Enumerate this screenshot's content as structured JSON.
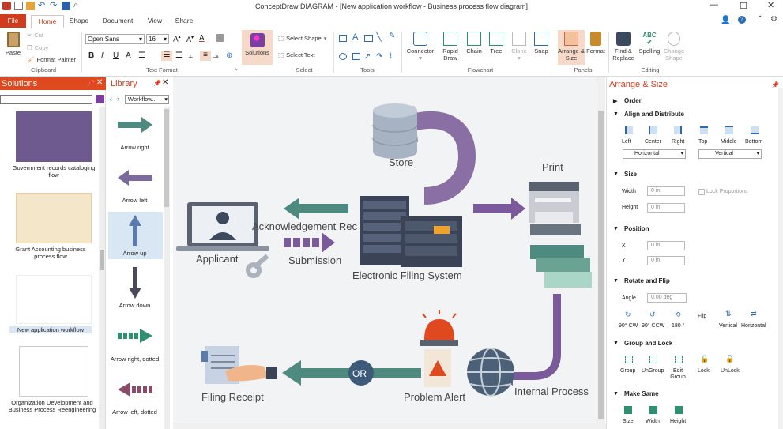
{
  "app": {
    "title": "ConceptDraw DIAGRAM - [New application workflow - Business process flow diagram]"
  },
  "ribbon_tabs": [
    "File",
    "Home",
    "Shape",
    "Document",
    "View",
    "Share"
  ],
  "ribbon": {
    "clipboard": {
      "paste": "Paste",
      "cut": "Cut",
      "copy": "Copy",
      "format_painter": "Format Painter",
      "label": "Clipboard"
    },
    "text_format": {
      "font": "Open Sans",
      "size": "16",
      "label": "Text Format"
    },
    "select": {
      "solutions": "Solutions",
      "select_shape": "Select Shape",
      "select_text": "Select Text",
      "label": "Select"
    },
    "tools": {
      "label": "Tools"
    },
    "flowchart": {
      "connector": "Connector",
      "rapid_draw": "Rapid Draw",
      "chain": "Chain",
      "tree": "Tree",
      "clone": "Clone",
      "snap": "Snap",
      "label": "Flowchart"
    },
    "panels": {
      "arrange_size": "Arrange & Size",
      "format": "Format",
      "label": "Panels"
    },
    "editing": {
      "find_replace": "Find & Replace",
      "spelling": "Spelling",
      "change_shape": "Change Shape",
      "label": "Editing"
    }
  },
  "solutions_panel": {
    "title": "Solutions",
    "items": [
      {
        "caption": "Government records cataloging flow"
      },
      {
        "caption": "Grant Accounting business process flow"
      },
      {
        "caption": "New application workflow"
      },
      {
        "caption": "Organization Development and Business Process Reengineering"
      }
    ]
  },
  "library_panel": {
    "title": "Library",
    "dropdown": "Workflow...",
    "items": [
      {
        "caption": "Arrow right"
      },
      {
        "caption": "Arrow left"
      },
      {
        "caption": "Arrow up"
      },
      {
        "caption": "Arrow down"
      },
      {
        "caption": "Arrow right, dotted"
      },
      {
        "caption": "Arrow left, dotted"
      }
    ]
  },
  "canvas": {
    "labels": {
      "store": "Store",
      "print": "Print",
      "applicant": "Applicant",
      "acknowledgement": "Acknowledgement Rec",
      "submission": "Submission",
      "efs": "Electronic Filing System",
      "filing_receipt": "Filing Receipt",
      "or": "OR",
      "problem_alert": "Problem Alert",
      "internal_process": "Internal Process"
    }
  },
  "arrange_panel": {
    "title": "Arrange & Size",
    "order": "Order",
    "align": {
      "title": "Align and Distribute",
      "buttons": [
        "Left",
        "Center",
        "Right",
        "Top",
        "Middle",
        "Bottom"
      ],
      "horizontal": "Horizontal",
      "vertical": "Vertical"
    },
    "size": {
      "title": "Size",
      "width_label": "Width",
      "width": "0 in",
      "height_label": "Height",
      "height": "0 in",
      "lock": "Lock Proportions"
    },
    "position": {
      "title": "Position",
      "x_label": "X",
      "x": "0 in",
      "y_label": "Y",
      "y": "0 in"
    },
    "rotate": {
      "title": "Rotate and Flip",
      "angle_label": "Angle",
      "angle": "0.00 deg",
      "buttons": [
        "90° CW",
        "90° CCW",
        "180 °"
      ],
      "flip": "Flip",
      "flip_buttons": [
        "Vertical",
        "Horizontal"
      ]
    },
    "group": {
      "title": "Group and Lock",
      "buttons": [
        "Group",
        "UnGroup",
        "Edit Group",
        "Lock",
        "UnLock"
      ]
    },
    "make_same": {
      "title": "Make Same",
      "buttons": [
        "Size",
        "Width",
        "Height"
      ]
    }
  },
  "colors": {
    "accent": "#d13b1e",
    "arrow": "#7b6a9c",
    "teal_arrow": "#4e8a80",
    "purple_big": "#8a6fa5"
  }
}
